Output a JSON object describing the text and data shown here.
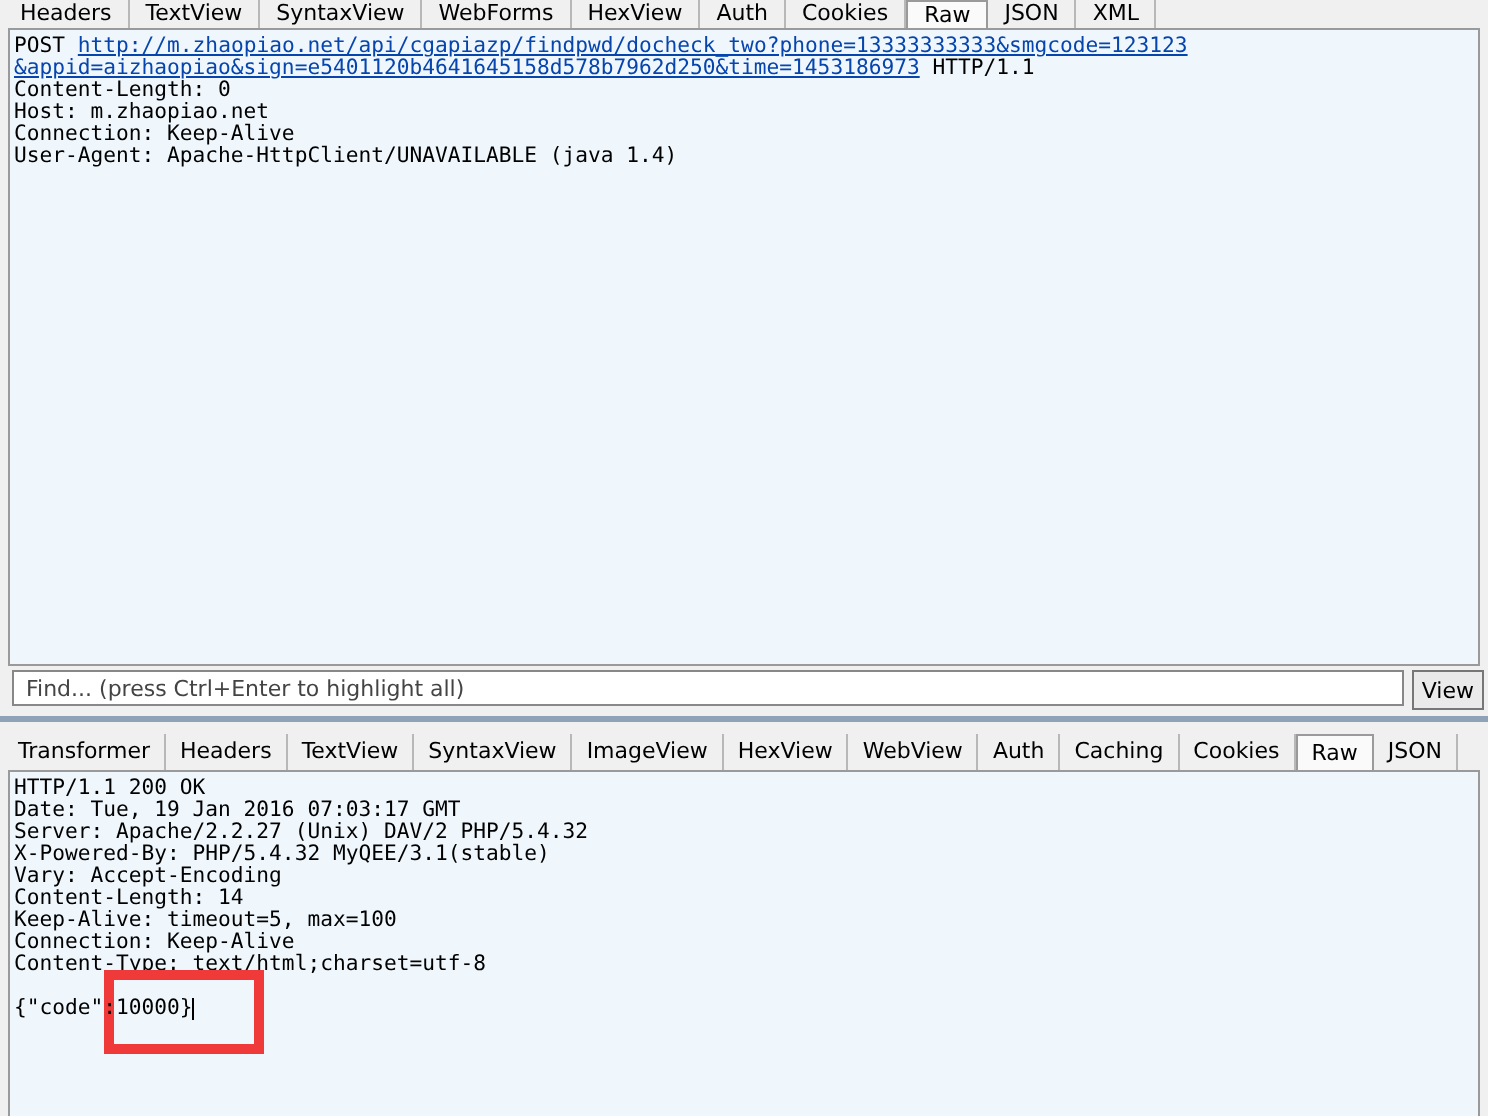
{
  "request_tabs": [
    {
      "label": "Headers",
      "selected": false
    },
    {
      "label": "TextView",
      "selected": false
    },
    {
      "label": "SyntaxView",
      "selected": false
    },
    {
      "label": "WebForms",
      "selected": false
    },
    {
      "label": "HexView",
      "selected": false
    },
    {
      "label": "Auth",
      "selected": false
    },
    {
      "label": "Cookies",
      "selected": false
    },
    {
      "label": "Raw",
      "selected": true
    },
    {
      "label": "JSON",
      "selected": false
    },
    {
      "label": "XML",
      "selected": false
    }
  ],
  "request": {
    "method": "POST",
    "url_lines": [
      "http://m.zhaopiao.net/api/cgapiazp/findpwd/docheck_two?phone=13333333333&smgcode=123123",
      "&appid=aizhaopiao&sign=e5401120b4641645158d578b7962d250&time=1453186973"
    ],
    "version": "HTTP/1.1",
    "headers": [
      "Content-Length: 0",
      "Host: m.zhaopiao.net",
      "Connection: Keep-Alive",
      "User-Agent: Apache-HttpClient/UNAVAILABLE (java 1.4)"
    ]
  },
  "find": {
    "placeholder": "Find... (press Ctrl+Enter to highlight all)",
    "button": "View"
  },
  "response_tabs": [
    {
      "label": "Transformer",
      "selected": false
    },
    {
      "label": "Headers",
      "selected": false
    },
    {
      "label": "TextView",
      "selected": false
    },
    {
      "label": "SyntaxView",
      "selected": false
    },
    {
      "label": "ImageView",
      "selected": false
    },
    {
      "label": "HexView",
      "selected": false
    },
    {
      "label": "WebView",
      "selected": false
    },
    {
      "label": "Auth",
      "selected": false
    },
    {
      "label": "Caching",
      "selected": false
    },
    {
      "label": "Cookies",
      "selected": false
    },
    {
      "label": "Raw",
      "selected": true
    },
    {
      "label": "JSON",
      "selected": false
    }
  ],
  "response": {
    "lines": [
      "HTTP/1.1 200 OK",
      "Date: Tue, 19 Jan 2016 07:03:17 GMT",
      "Server: Apache/2.2.27 (Unix) DAV/2 PHP/5.4.32",
      "X-Powered-By: PHP/5.4.32 MyQEE/3.1(stable)",
      "Vary: Accept-Encoding",
      "Content-Length: 14",
      "Keep-Alive: timeout=5, max=100",
      "Connection: Keep-Alive",
      "Content-Type: text/html;charset=utf-8"
    ],
    "body": "{\"code\":10000}"
  }
}
